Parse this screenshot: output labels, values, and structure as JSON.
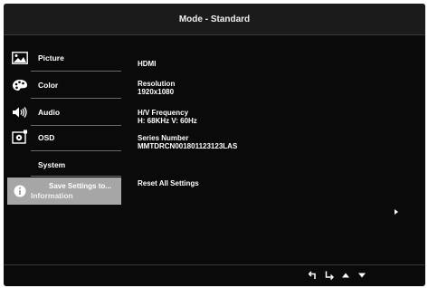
{
  "header": {
    "title": "Mode - Standard"
  },
  "sidebar": {
    "items": [
      {
        "label": "Picture",
        "icon": "picture-icon"
      },
      {
        "label": "Color",
        "icon": "palette-icon"
      },
      {
        "label": "Audio",
        "icon": "speaker-icon"
      },
      {
        "label": "OSD",
        "icon": "osd-gear-icon"
      },
      {
        "label": "System",
        "icon": ""
      },
      {
        "label": "Information",
        "icon": "info-icon",
        "overlay_label": "Save Settings to..."
      }
    ]
  },
  "content": {
    "input_source": "HDMI",
    "resolution_label": "Resolution",
    "resolution_value": "1920x1080",
    "frequency_label": "H/V Frequency",
    "frequency_value": "H: 68KHz V: 60Hz",
    "serial_label": "Series Number",
    "serial_value": "MMTDRCN001801123123LAS",
    "reset_label": "Reset All Settings"
  },
  "footer": {
    "icons": [
      "back-icon",
      "enter-icon",
      "up-icon",
      "down-icon"
    ]
  },
  "colors": {
    "background": "#0a0a0a",
    "header": "#1b1b1b",
    "selected": "#a6a6a6",
    "text": "#ffffff"
  }
}
